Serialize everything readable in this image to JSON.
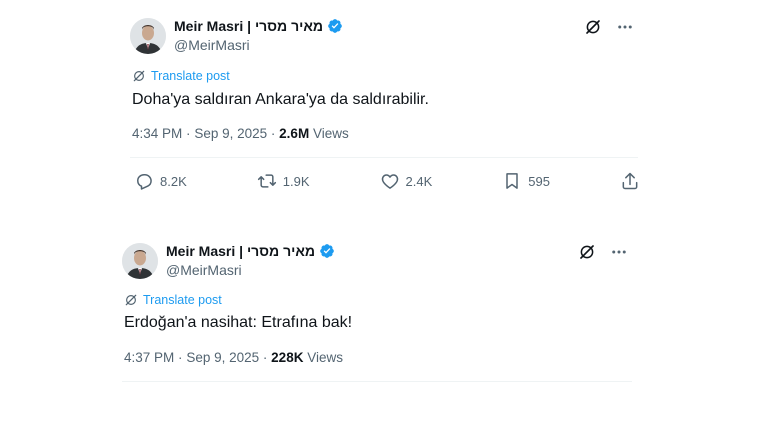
{
  "tweets": [
    {
      "author": "Meir Masri | מאיר מסרי",
      "handle": "@MeirMasri",
      "translate_label": "Translate post",
      "text": "Doha'ya saldıran Ankara'ya da saldırabilir.",
      "time": "4:34 PM",
      "separator": "·",
      "date": "Sep 9, 2025",
      "views_count": "2.6M",
      "views_label": "Views",
      "replies": "8.2K",
      "reposts": "1.9K",
      "likes": "2.4K",
      "bookmarks": "595",
      "icons": [
        "grok-icon",
        "more-icon",
        "translate-icon",
        "reply-icon",
        "repost-icon",
        "like-icon",
        "bookmark-icon",
        "share-icon"
      ]
    },
    {
      "author": "Meir Masri | מאיר מסרי",
      "handle": "@MeirMasri",
      "translate_label": "Translate post",
      "text": "Erdoğan'a nasihat: Etrafına bak!",
      "time": "4:37 PM",
      "separator": "·",
      "date": "Sep 9, 2025",
      "views_count": "228K",
      "views_label": "Views",
      "icons": [
        "grok-icon",
        "more-icon",
        "translate-icon"
      ]
    }
  ],
  "colors": {
    "link": "#1d9bf0",
    "verified": "#1d9bf0",
    "secondary_text": "#536471",
    "primary_text": "#0f1419"
  }
}
